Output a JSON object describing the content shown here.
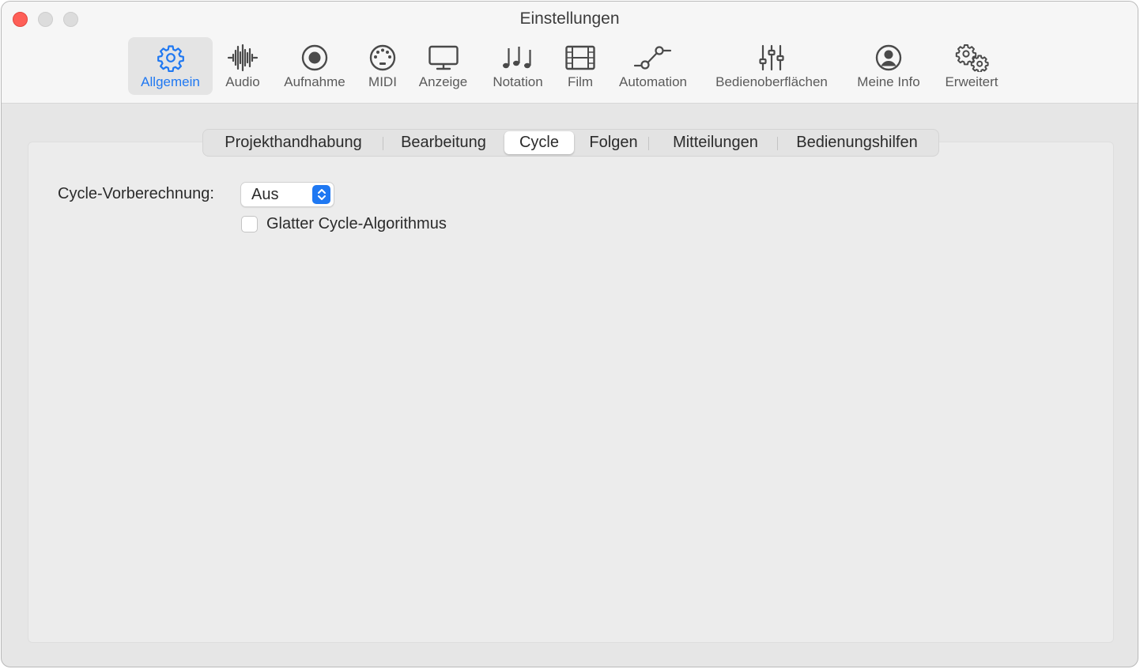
{
  "window": {
    "title": "Einstellungen"
  },
  "toolbar": {
    "items": [
      {
        "label": "Allgemein",
        "icon": "gear-icon",
        "active": true
      },
      {
        "label": "Audio",
        "icon": "waveform-icon"
      },
      {
        "label": "Aufnahme",
        "icon": "record-icon"
      },
      {
        "label": "MIDI",
        "icon": "midi-connector-icon"
      },
      {
        "label": "Anzeige",
        "icon": "display-icon"
      },
      {
        "label": "Notation",
        "icon": "music-notes-icon"
      },
      {
        "label": "Film",
        "icon": "film-strip-icon"
      },
      {
        "label": "Automation",
        "icon": "automation-curve-icon"
      },
      {
        "label": "Bedienoberflächen",
        "icon": "sliders-icon"
      },
      {
        "label": "Meine Info",
        "icon": "person-circle-icon"
      },
      {
        "label": "Erweitert",
        "icon": "gears-icon"
      }
    ]
  },
  "tabs": {
    "items": [
      {
        "label": "Projekthandhabung"
      },
      {
        "label": "Bearbeitung"
      },
      {
        "label": "Cycle",
        "active": true
      },
      {
        "label": "Folgen"
      },
      {
        "label": "Mitteilungen"
      },
      {
        "label": "Bedienungshilfen"
      }
    ]
  },
  "cycle": {
    "precompute_label": "Cycle-Vorberechnung:",
    "precompute_value": "Aus",
    "smooth_label": "Glatter Cycle-Algorithmus",
    "smooth_checked": false
  },
  "colors": {
    "accent": "#1f78f2",
    "close": "#fe5f57"
  }
}
